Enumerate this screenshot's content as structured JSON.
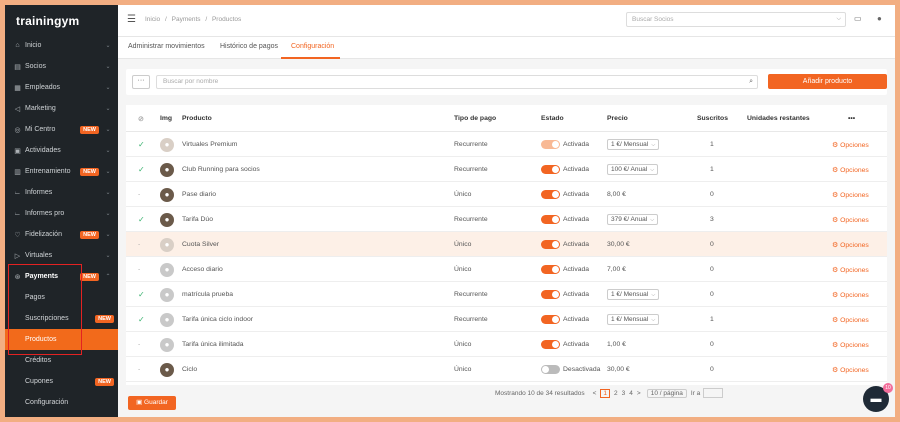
{
  "app": {
    "logo": "trainingym"
  },
  "sidebar": {
    "items": [
      {
        "icon": "home-icon",
        "glyph": "⌂",
        "label": "Inicio"
      },
      {
        "icon": "socios-icon",
        "glyph": "▤",
        "label": "Socios"
      },
      {
        "icon": "employees-icon",
        "glyph": "▦",
        "label": "Empleados"
      },
      {
        "icon": "marketing-icon",
        "glyph": "◁",
        "label": "Marketing"
      },
      {
        "icon": "center-icon",
        "glyph": "◎",
        "label": "Mi Centro",
        "badge": "NEW"
      },
      {
        "icon": "calendar-icon",
        "glyph": "▣",
        "label": "Actividades"
      },
      {
        "icon": "training-icon",
        "glyph": "▥",
        "label": "Entrenamiento",
        "badge": "NEW"
      },
      {
        "icon": "reports-icon",
        "glyph": "⌳",
        "label": "Informes"
      },
      {
        "icon": "reports-pro-icon",
        "glyph": "⌳",
        "label": "Informes pro"
      },
      {
        "icon": "loyalty-icon",
        "glyph": "♡",
        "label": "Fidelización",
        "badge": "NEW"
      },
      {
        "icon": "virtual-icon",
        "glyph": "▷",
        "label": "Virtuales"
      },
      {
        "icon": "payments-icon",
        "glyph": "⊛",
        "label": "Payments",
        "badge": "NEW"
      }
    ],
    "sub_items": [
      {
        "label": "Pagos"
      },
      {
        "label": "Suscripciones",
        "badge": "NEW"
      },
      {
        "label": "Productos"
      },
      {
        "label": "Créditos"
      },
      {
        "label": "Cupones",
        "badge": "NEW"
      },
      {
        "label": "Configuración"
      }
    ]
  },
  "topbar": {
    "breadcrumb": [
      "Inicio",
      "/",
      "Payments",
      "/",
      "Productos"
    ],
    "search_placeholder": "Buscar Socios"
  },
  "tabs": [
    "Administrar movimientos",
    "Histórico de pagos",
    "Configuración"
  ],
  "filters": {
    "more": "···",
    "search_placeholder": "Buscar por nombre",
    "add_label": "Añadir producto"
  },
  "table": {
    "headers": [
      "Img",
      "Producto",
      "Tipo de pago",
      "Estado",
      "Precio",
      "Suscritos",
      "Unidades restantes",
      "•••"
    ],
    "rows": [
      {
        "check": "✓",
        "name": "Virtuales Premium",
        "type": "Recurrente",
        "state": "Activada",
        "price": "1 €/ Mensual",
        "select": true,
        "subs": "1",
        "opt": "Opciones"
      },
      {
        "check": "✓",
        "name": "Club Running para socios",
        "type": "Recurrente",
        "state": "Activada",
        "price": "100 €/ Anual",
        "select": true,
        "subs": "1",
        "opt": "Opciones"
      },
      {
        "check": "-",
        "name": "Pase diario",
        "type": "Único",
        "state": "Activada",
        "price": "8,00 €",
        "select": false,
        "subs": "0",
        "opt": "Opciones"
      },
      {
        "check": "✓",
        "name": "Tarifa Dúo",
        "type": "Recurrente",
        "state": "Activada",
        "price": "379 €/ Anual",
        "select": true,
        "subs": "3",
        "opt": "Opciones"
      },
      {
        "check": "-",
        "name": "Cuota Silver",
        "type": "Único",
        "state": "Activada",
        "price": "30,00 €",
        "select": false,
        "subs": "0",
        "opt": "Opciones"
      },
      {
        "check": "-",
        "name": "Acceso diario",
        "type": "Único",
        "state": "Activada",
        "price": "7,00 €",
        "select": false,
        "subs": "0",
        "opt": "Opciones"
      },
      {
        "check": "✓",
        "name": "matrícula prueba",
        "type": "Recurrente",
        "state": "Activada",
        "price": "1 €/ Mensual",
        "select": true,
        "subs": "0",
        "opt": "Opciones"
      },
      {
        "check": "✓",
        "name": "Tarifa única ciclo indoor",
        "type": "Recurrente",
        "state": "Activada",
        "price": "1 €/ Mensual",
        "select": true,
        "subs": "1",
        "opt": "Opciones"
      },
      {
        "check": "-",
        "name": "Tarifa única ilimitada",
        "type": "Único",
        "state": "Activada",
        "price": "1,00 €",
        "select": false,
        "subs": "0",
        "opt": "Opciones"
      },
      {
        "check": "-",
        "name": "Ciclo",
        "type": "Único",
        "state": "Desactivada",
        "price": "30,00 €",
        "select": false,
        "subs": "0",
        "opt": "Opciones"
      }
    ]
  },
  "pager": {
    "summary": "Mostrando 10 de 34 resultados",
    "prev": "<",
    "pages": [
      "1",
      "2",
      "3",
      "4"
    ],
    "next": ">",
    "per_page": "10 / página",
    "goto": "Ir a"
  },
  "footer": {
    "save_label": "Guardar"
  },
  "chat": {
    "badge": "10"
  },
  "colors": {
    "accent": "#f26522",
    "sidebar_bg": "#1f2428",
    "success": "#3cb371",
    "highlight_box": "#e32222"
  }
}
